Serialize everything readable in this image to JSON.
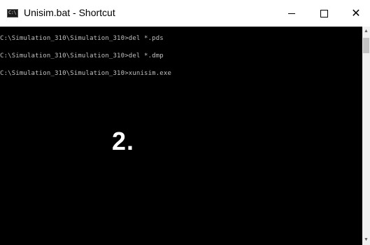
{
  "window": {
    "title": "Unisim.bat - Shortcut",
    "icon_text": "C:\\",
    "icons": {
      "app": "command-prompt-icon",
      "minimize": "minimize-icon",
      "maximize": "maximize-icon",
      "close": "close-icon",
      "scroll_up": "chevron-up-icon",
      "scroll_down": "chevron-down-icon"
    },
    "close_glyph": "✕",
    "scroll_up_glyph": "▲",
    "scroll_down_glyph": "▼"
  },
  "console": {
    "lines": [
      "C:\\Simulation_310\\Simulation_310>del *.pds",
      "C:\\Simulation_310\\Simulation_310>del *.dmp",
      "C:\\Simulation_310\\Simulation_310>xunisim.exe"
    ],
    "background": "#000000",
    "text_color": "#c0c0c0"
  },
  "overlay": {
    "label": "2."
  }
}
